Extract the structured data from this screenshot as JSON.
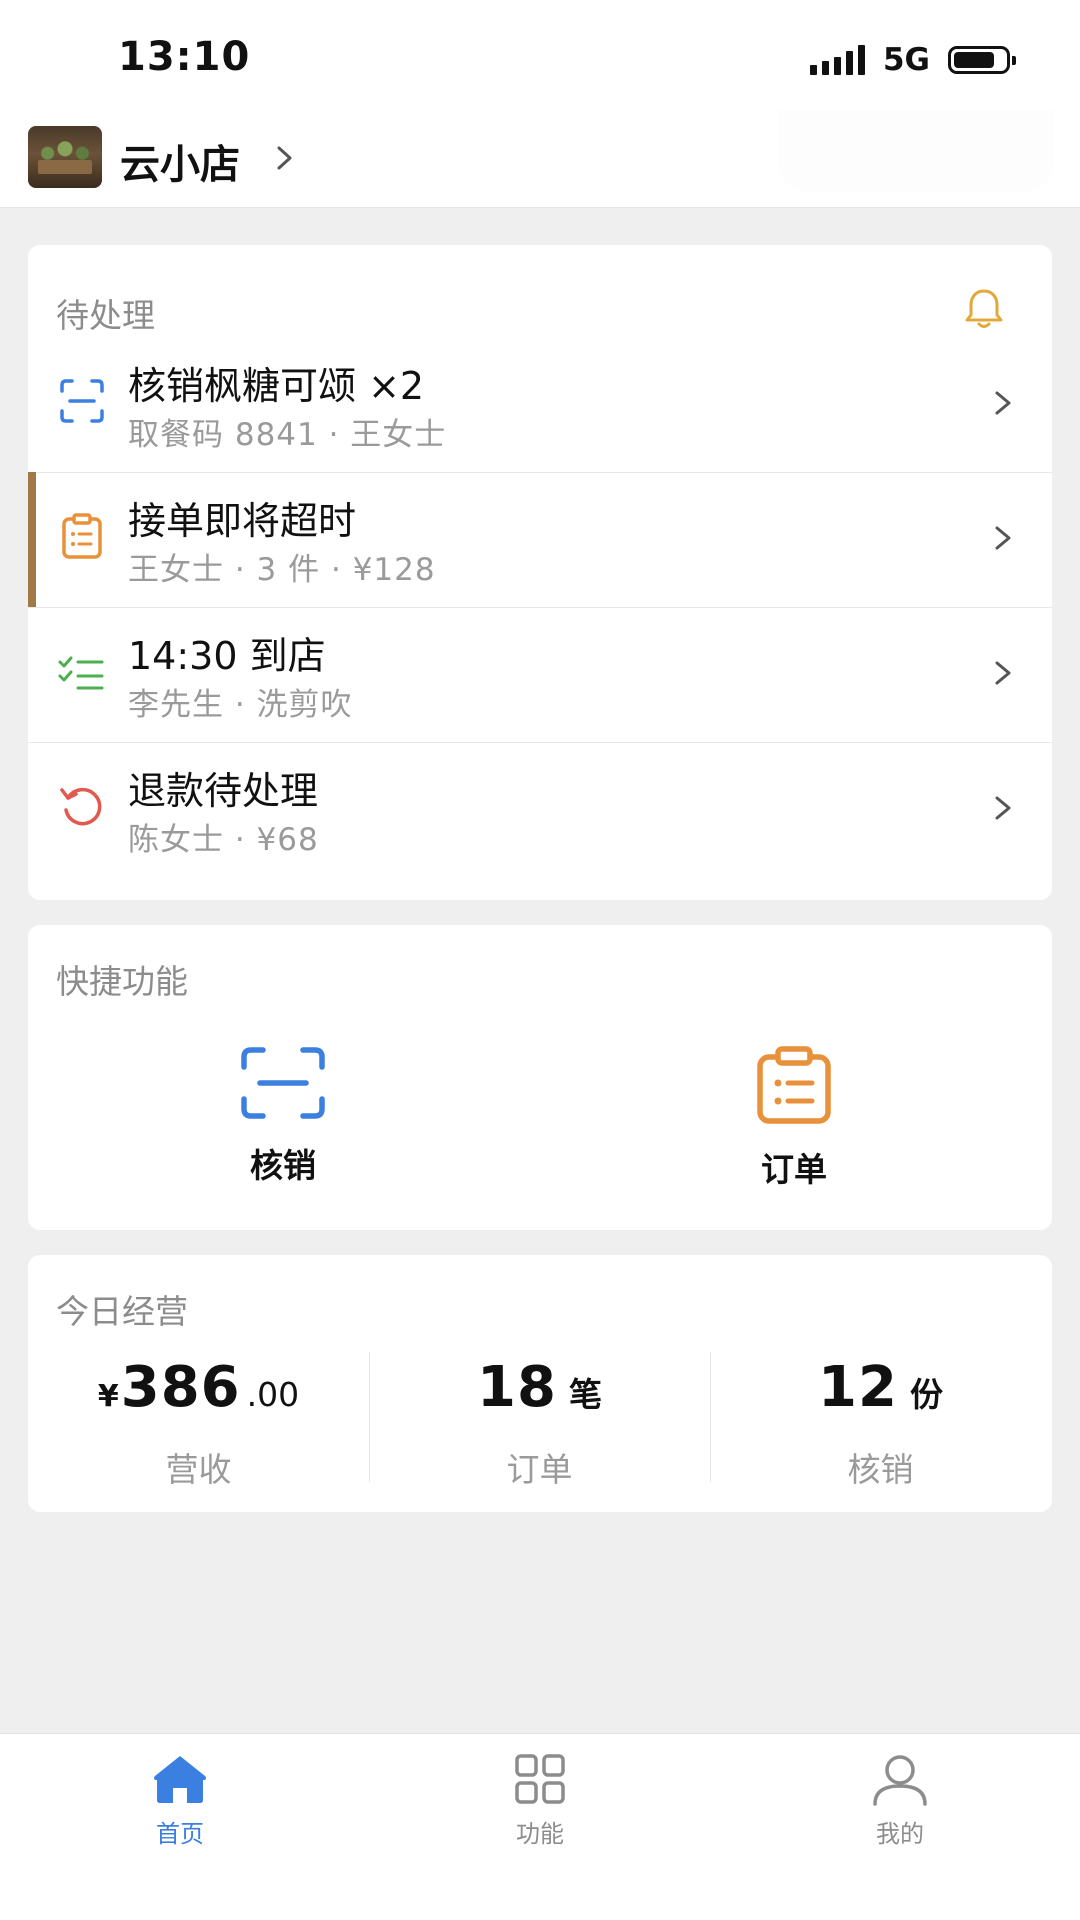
{
  "status_bar": {
    "time": "13:10",
    "network": "5G",
    "battery_level": 0.8
  },
  "shop": {
    "name": "云小店",
    "avatar_icon": "shop-photo"
  },
  "pending": {
    "title": "待处理",
    "bell_color": "#e2a93a",
    "items": [
      {
        "title": "核销枫糖可颂 ×2",
        "subtitle": "取餐码 8841 · 王女士",
        "icon": "scan-icon",
        "color": "#3b7fe0"
      },
      {
        "title": "接单即将超时",
        "subtitle": "王女士 · 3 件 · ¥128",
        "icon": "clipboard-icon",
        "color": "#e8913a",
        "highlighted": true
      },
      {
        "title": "14:30 到店",
        "subtitle": "李先生 · 洗剪吹",
        "icon": "checklist-icon",
        "color": "#4caf50"
      },
      {
        "title": "退款待处理",
        "subtitle": "陈女士 · ¥68",
        "icon": "refund-icon",
        "color": "#e05a4e"
      }
    ]
  },
  "quick": {
    "title": "快捷功能",
    "items": [
      {
        "label": "核销",
        "icon": "scan-icon",
        "color": "#3b7fe0"
      },
      {
        "label": "订单",
        "icon": "clipboard-icon",
        "color": "#e8913a"
      }
    ]
  },
  "stats": {
    "title": "今日经营",
    "revenue": {
      "prefix": "¥",
      "main": "386",
      "decimal": ".00",
      "label": "营收"
    },
    "orders": {
      "main": "18",
      "unit": "笔",
      "label": "订单"
    },
    "verifications": {
      "main": "12",
      "unit": "份",
      "label": "核销"
    }
  },
  "tabs": [
    {
      "label": "首页",
      "icon": "home-icon",
      "active": true
    },
    {
      "label": "功能",
      "icon": "grid-icon",
      "active": false
    },
    {
      "label": "我的",
      "icon": "user-icon",
      "active": false
    }
  ],
  "colors": {
    "accent_blue": "#3b7fe0",
    "accent_orange": "#e8913a",
    "accent_green": "#4caf50",
    "accent_red": "#e05a4e",
    "highlight_bar": "#a07a45"
  }
}
